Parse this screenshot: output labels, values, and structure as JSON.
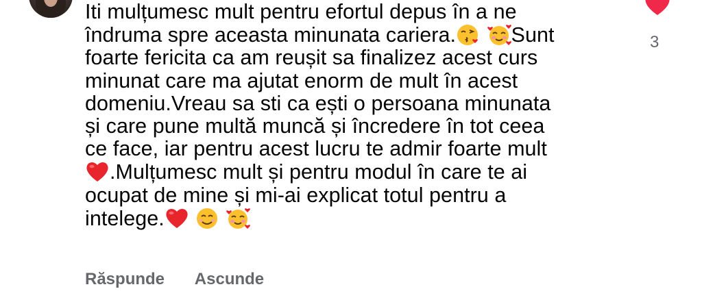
{
  "comment": {
    "lines": [
      "Iti mulțumesc mult pentru efortul depus în a ne",
      "îndruma spre aceasta minunata cariera.",
      "Sunt",
      "foarte fericita ca am reușit sa finalizez acest curs",
      "minunat care ma ajutat enorm de mult în acest",
      "domeniu.Vreau sa sti ca ești o persoana minunata",
      "și care pune multă muncă și încredere  în tot ceea",
      "ce face,  iar pentru acest lucru te admir foarte mult",
      ".Mulțumesc mult și pentru modul în care te ai",
      "ocupat de mine și mi-ai explicat totul pentru a",
      "intelege."
    ],
    "emojis": [
      "kissing-face-icon",
      "smiling-face-with-hearts-icon",
      "red-heart-icon",
      "smiling-face-icon"
    ]
  },
  "actions": {
    "reply_label": "Răspunde",
    "hide_label": "Ascunde"
  },
  "reaction": {
    "count": "3",
    "heart_color": "#f02849"
  }
}
